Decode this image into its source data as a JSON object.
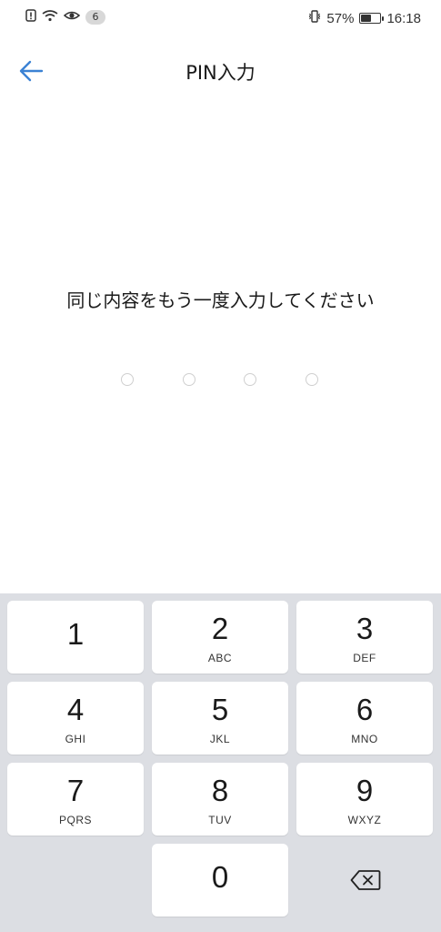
{
  "status_bar": {
    "notification_count": "6",
    "battery_percent": "57%",
    "battery_level": 0.57,
    "time": "16:18",
    "icons": [
      "alert-icon",
      "wifi-icon",
      "eye-icon",
      "vibrate-icon",
      "battery-icon"
    ]
  },
  "header": {
    "title": "PIN入力",
    "back_icon": "arrow-left-icon",
    "accent_color": "#3b82d4"
  },
  "prompt": "同じ内容をもう一度入力してください",
  "pin": {
    "length": 4,
    "entered": 0
  },
  "keypad": {
    "keys": [
      {
        "digit": "1",
        "letters": ""
      },
      {
        "digit": "2",
        "letters": "ABC"
      },
      {
        "digit": "3",
        "letters": "DEF"
      },
      {
        "digit": "4",
        "letters": "GHI"
      },
      {
        "digit": "5",
        "letters": "JKL"
      },
      {
        "digit": "6",
        "letters": "MNO"
      },
      {
        "digit": "7",
        "letters": "PQRS"
      },
      {
        "digit": "8",
        "letters": "TUV"
      },
      {
        "digit": "9",
        "letters": "WXYZ"
      },
      {
        "digit": "0",
        "letters": ""
      }
    ],
    "backspace_icon": "backspace-icon"
  }
}
